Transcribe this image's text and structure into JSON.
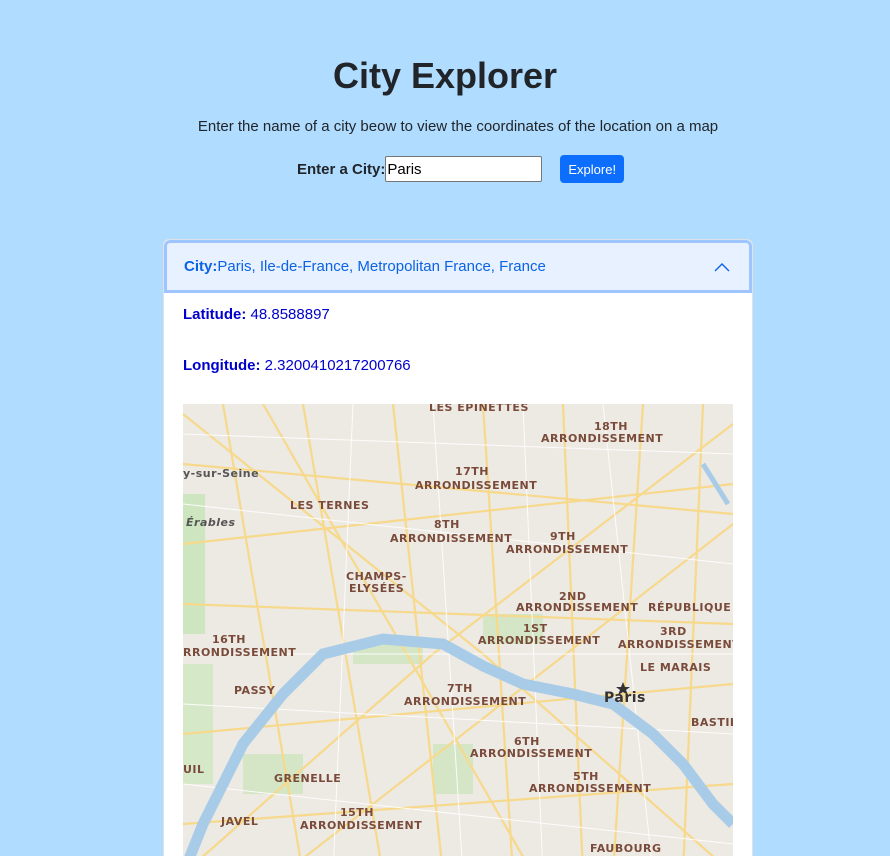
{
  "header": {
    "title": "City Explorer",
    "subtitle": "Enter the name of a city beow to view the coordinates of the location on a map"
  },
  "search": {
    "label": "Enter a City:",
    "value": "Paris",
    "button_label": "Explore!"
  },
  "result": {
    "city_label": "City:",
    "city_value": "Paris, Ile-de-France, Metropolitan France, France",
    "latitude_label": "Latitude:",
    "latitude_value": "48.8588897",
    "longitude_label": "Longitude:",
    "longitude_value": "2.3200410217200766"
  },
  "map": {
    "labels": [
      "LES EPINETTES",
      "18TH",
      "ARRONDISSEMENT",
      "17TH",
      "ARRONDISSEMENT",
      "LES TERNES",
      "8TH",
      "ARRONDISSEMENT",
      "9TH",
      "ARRONDISSEMENT",
      "CHAMPS-",
      "ELYSÉES",
      "2ND",
      "ARRONDISSEMENT",
      "RÉPUBLIQUE",
      "1ST",
      "ARRONDISSEMENT",
      "3RD",
      "ARRONDISSEMENT",
      "16TH",
      "RRONDISSEMENT",
      "LE MARAIS",
      "PASSY",
      "7TH",
      "ARRONDISSEMENT",
      "Paris",
      "BASTIL",
      "6TH",
      "ARRONDISSEMENT",
      "UIL",
      "GRENELLE",
      "5TH",
      "ARRONDISSEMENT",
      "15TH",
      "JAVEL",
      "ARRONDISSEMENT",
      "FAUBOURG",
      "y-sur-Seine",
      "Érables"
    ]
  },
  "colors": {
    "page_bg": "#afdcff",
    "accent": "#0d6efd",
    "header_bg": "#e7f1ff",
    "coord_text": "#0000cd"
  }
}
